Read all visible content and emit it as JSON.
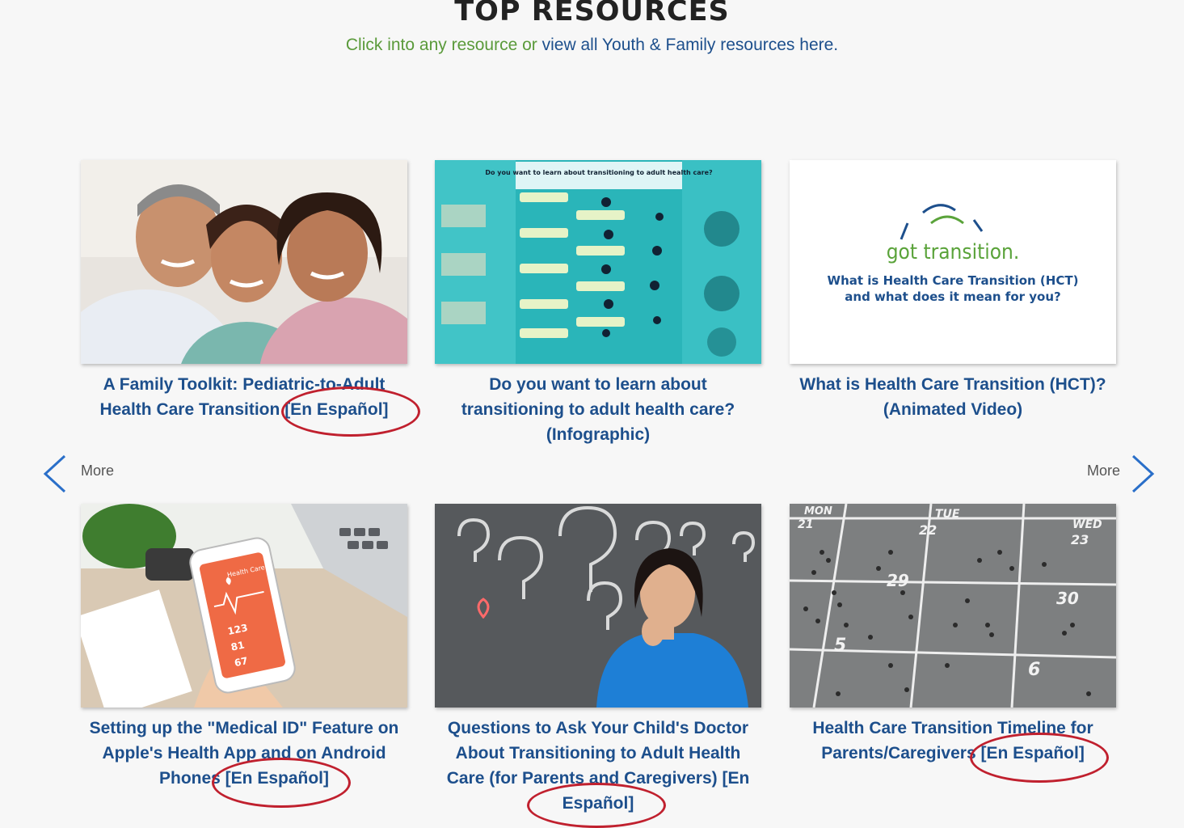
{
  "header": {
    "title": "TOP RESOURCES",
    "subtitle_pre": "Click into any resource or ",
    "subtitle_link": "view all Youth & Family resources here."
  },
  "nav": {
    "prev_label": "More",
    "next_label": "More"
  },
  "cards": [
    {
      "title": "A Family Toolkit: Pediatric-to-Adult Health Care Transition ",
      "espanol": "[En Español]"
    },
    {
      "title": "Do you want to learn about transitioning to adult health care? (Infographic)",
      "espanol": ""
    },
    {
      "title": "What is Health Care Transition (HCT)? (Animated Video)",
      "espanol": ""
    },
    {
      "title": "Setting up the \"Medical ID\" Feature on Apple's Health App and on Android Phones ",
      "espanol": "[En Español]"
    },
    {
      "title": "Questions to Ask Your Child's Doctor About Transitioning to Adult Health Care (for Parents and Caregivers) ",
      "espanol": "[En Español]"
    },
    {
      "title": "Health Care Transition Timeline for Parents/Caregivers ",
      "espanol": "[En Español]"
    }
  ],
  "thumb_text": {
    "infographic_heading": "Do you want to learn about transitioning to adult health care?",
    "got_transition_logo": "got transition.",
    "hct_line1": "What is Health Care Transition (HCT)",
    "hct_line2": "and what does it mean for you?",
    "phone_header": "Health Care",
    "phone_v1": "123",
    "phone_v2": "81",
    "phone_v3": "67",
    "days": [
      "MON",
      "TUE",
      "WED"
    ],
    "dates": [
      "21",
      "22",
      "23",
      "29",
      "30",
      "5",
      "6"
    ]
  },
  "colors": {
    "accent": "#1d4f8c",
    "highlight_ring": "#c0202e",
    "subtitle_green": "#5a9a3a"
  }
}
